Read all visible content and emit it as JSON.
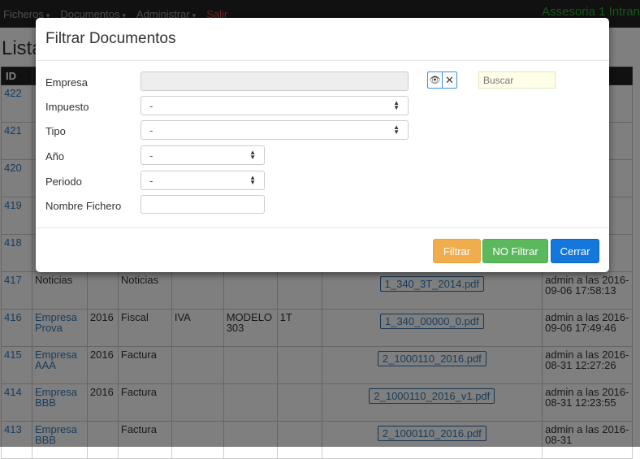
{
  "navbar": {
    "items": [
      "Ficheros",
      "Documentos",
      "Administrar"
    ],
    "salir": "Salir",
    "brand": "Assesoria 1 Intran",
    "caret": "▾"
  },
  "page": {
    "title": "Lista",
    "table_header_id": "ID",
    "rows": [
      {
        "id": "422"
      },
      {
        "id": "421"
      },
      {
        "id": "420"
      },
      {
        "id": "419"
      },
      {
        "id": "418"
      },
      {
        "id": "417",
        "empresa": "Noticias",
        "anio": "",
        "tipo": "Noticias",
        "impuesto": "",
        "modelo": "",
        "periodo": "",
        "fichero": "1_340_3T_2014.pdf",
        "fecha": "admin a las 2016-09-06 17:58:13"
      },
      {
        "id": "416",
        "empresa": "Empresa Prova",
        "anio": "2016",
        "tipo": "Fiscal",
        "impuesto": "IVA",
        "modelo": "MODELO 303",
        "periodo": "1T",
        "fichero": "1_340_00000_0.pdf",
        "fecha": "admin a las 2016-09-06 17:49:46"
      },
      {
        "id": "415",
        "empresa": "Empresa AAA",
        "anio": "2016",
        "tipo": "Factura",
        "impuesto": "",
        "modelo": "",
        "periodo": "",
        "fichero": "2_1000110_2016.pdf",
        "fecha": "admin a las 2016-08-31 12:27:26"
      },
      {
        "id": "414",
        "empresa": "Empresa BBB",
        "anio": "2016",
        "tipo": "Factura",
        "impuesto": "",
        "modelo": "",
        "periodo": "",
        "fichero": "2_1000110_2016_v1.pdf",
        "fecha": "admin a las 2016-08-31 12:23:55"
      },
      {
        "id": "413",
        "empresa": "Empresa BBB",
        "anio": "",
        "tipo": "Factura",
        "impuesto": "",
        "modelo": "",
        "periodo": "",
        "fichero": "2_1000110_2016.pdf",
        "fecha": "admin a las 2016-08-31"
      }
    ]
  },
  "modal": {
    "title": "Filtrar Documentos",
    "labels": {
      "empresa": "Empresa",
      "impuesto": "Impuesto",
      "tipo": "Tipo",
      "anio": "Año",
      "periodo": "Periodo",
      "nombre_fichero": "Nombre Fichero"
    },
    "values": {
      "empresa": "",
      "impuesto": "-",
      "tipo": "-",
      "anio": "-",
      "periodo": "-",
      "nombre_fichero": ""
    },
    "search_placeholder": "Buscar",
    "eye_icon": "👁",
    "clear_icon": "✕",
    "buttons": {
      "filtrar": "Filtrar",
      "no_filtrar": "NO Filtrar",
      "cerrar": "Cerrar"
    },
    "colors": {
      "filtrar": "#f0ad4e",
      "no_filtrar": "#5cb85c",
      "cerrar": "#1477dc"
    }
  }
}
